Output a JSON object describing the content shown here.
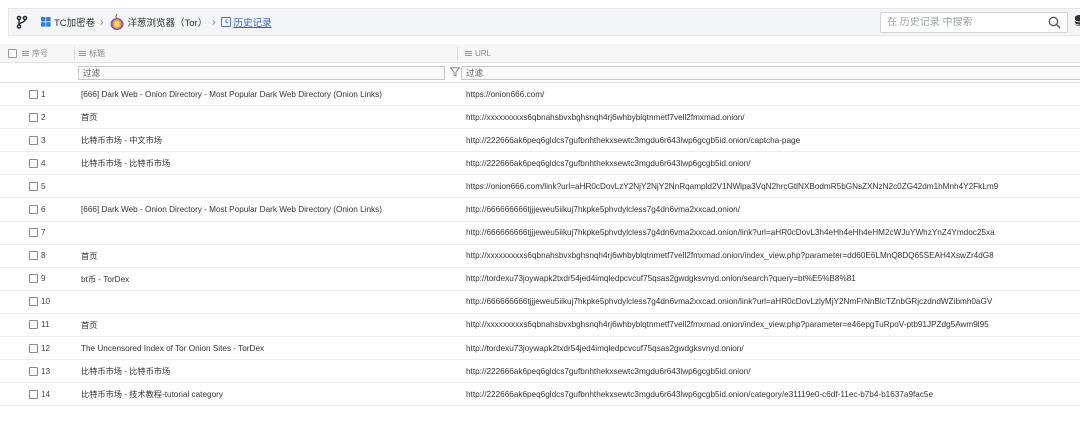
{
  "breadcrumb": {
    "items": [
      {
        "label": "TC加密卷",
        "icon": "vault-icon"
      },
      {
        "label": "洋葱浏览器（Tor）",
        "icon": "onion-icon"
      },
      {
        "label": "历史记录",
        "icon": "history-icon"
      }
    ]
  },
  "search": {
    "placeholder": "在 历史记录 中搜索"
  },
  "columns": {
    "index": "序号",
    "title": "标题",
    "url": "URL"
  },
  "filters": {
    "title": "过滤",
    "url": "过滤"
  },
  "rows": [
    {
      "idx": "1",
      "title": "[666] Dark Web - Onion Directory - Most Popular Dark Web Directory (Onion Links)",
      "url": "https://onion666.com/"
    },
    {
      "idx": "2",
      "title": "首页",
      "url": "http://xxxxxxxxxs6qbnahsbvxbghsnqh4rj6whbyblqtnmetf7vell2fmxmad.onion/"
    },
    {
      "idx": "3",
      "title": "比特币市场 - 中文市场",
      "url": "http://222666ak6peq6gldcs7gufbnhthekxsewtc3mgdu6r643lwp6gcgb5id.onion/captcha-page"
    },
    {
      "idx": "4",
      "title": "比特币市场 - 比特币市场",
      "url": "http://222666ak6peq6gldcs7gufbnhthekxsewtc3mgdu6r643lwp6gcgb5id.onion/"
    },
    {
      "idx": "5",
      "title": "",
      "url": "https://onion666.com/link?url=aHR0cDovLzY2NjY2NjY2NnRqampld2V1NWlpa3VqN2hrcGtlNXBodmR5bGNsZXNzN2c0ZG42dm1hMnh4Y2FkLm9"
    },
    {
      "idx": "6",
      "title": "[666] Dark Web - Onion Directory - Most Popular Dark Web Directory (Onion Links)",
      "url": "http://666666666tjjjeweu5iikuj7hkpke5phvdylcless7g4dn6vma2xxcad.onion/"
    },
    {
      "idx": "7",
      "title": "",
      "url": "http://666666666tjjjeweu5iikuj7hkpke5phvdylcless7g4dn6vma2xxcad.onion/link?url=aHR0cDovL3h4eHh4eHh4eHM2cWJuYWhzYnZ4Ymdoc25xa"
    },
    {
      "idx": "8",
      "title": "首页",
      "url": "http://xxxxxxxxxs6qbnahsbvxbghsnqh4rj6whbyblqtnmetf7vell2fmxmad.onion/index_view.php?parameter=dd60E6LMnQ8DQ65SEAH4XswZr4dG8"
    },
    {
      "idx": "9",
      "title": "bt币 - TorDex",
      "url": "http://tordexu73joywapk2txdr54jed4imqledpcvcuf75qsas2gwdgksvnyd.onion/search?query=bt%E5%B8%81"
    },
    {
      "idx": "10",
      "title": "",
      "url": "http://666666666tjjjeweu5iikuj7hkpke5phvdylcless7g4dn6vma2xxcad.onion/link?url=aHR0cDovLzlyMjY2NmFrNnBlcTZnbGRjczdndWZibmh0aGV"
    },
    {
      "idx": "11",
      "title": "首页",
      "url": "http://xxxxxxxxxs6qbnahsbvxbghsnqh4rj6whbyblqtnmetf7vell2fmxmad.onion/index_view.php?parameter=e46epgTuRpoV-ptb91JPZdg5Awm9l95"
    },
    {
      "idx": "12",
      "title": "The Uncensored Index of Tor Onion Sites - TorDex",
      "url": "http://tordexu73joywapk2txdr54jed4imqledpcvcuf75qsas2gwdgksvnyd.onion/"
    },
    {
      "idx": "13",
      "title": "比特币市场 - 比特币市场",
      "url": "http://222666ak6peq6gldcs7gufbnhthekxsewtc3mgdu6r643lwp6gcgb5id.onion/"
    },
    {
      "idx": "14",
      "title": "比特币市场 - 技术教程-tutorial category",
      "url": "http://222666ak6peq6gldcs7gufbnhthekxsewtc3mgdu6r643lwp6gcgb5id.onion/category/e31119e0-c6df-11ec-b7b4-b1637a9fac5e"
    }
  ]
}
